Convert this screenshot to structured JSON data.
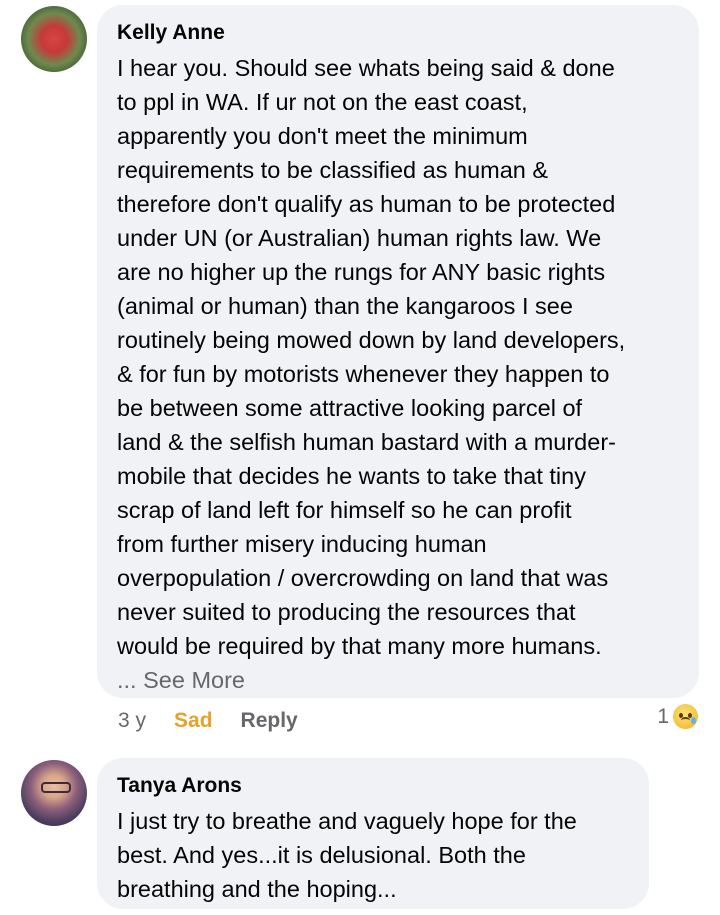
{
  "comments": [
    {
      "author": "Kelly Anne",
      "text": "I hear you. Should see whats being said & done\nto ppl in WA. If ur not on the east coast,\napparently you don't meet the minimum\nrequirements to be classified as human &\ntherefore don't qualify as human to be protected\nunder UN (or Australian) human rights law. We\nare no higher up the rungs for ANY basic rights\n(animal or human) than the kangaroos I see\nroutinely being mowed down by land developers,\n& for fun by motorists whenever they happen to\nbe between some attractive looking parcel of\nland & the selfish human bastard with a murder-\nmobile that decides he wants to take that tiny\nscrap of land left for himself so he can profit\nfrom further misery inducing human\noverpopulation / overcrowding on land that was\nnever suited to producing the resources that\nwould be required by that many more humans.",
      "see_more": "... See More",
      "time": "3 y",
      "reaction_label": "Sad",
      "reply_label": "Reply",
      "reaction_count": "1",
      "reaction_icon": "sad-emoji-icon"
    },
    {
      "author": "Tanya Arons",
      "text": "I just try to breathe and vaguely hope for the\nbest.  And yes...it is delusional. Both the\nbreathing and the hoping..."
    }
  ],
  "colors": {
    "bubble": "#f0f2f5",
    "secondary_text": "#65676b",
    "sad_reaction": "#e5a22a"
  }
}
